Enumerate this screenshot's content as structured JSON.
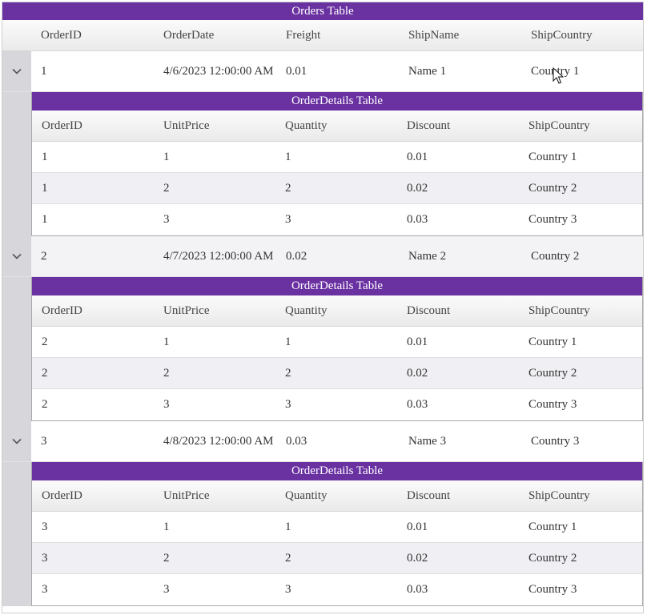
{
  "orders": {
    "caption": "Orders Table",
    "columns": [
      "OrderID",
      "OrderDate",
      "Freight",
      "ShipName",
      "ShipCountry"
    ],
    "rows": [
      {
        "cells": [
          "1",
          "4/6/2023 12:00:00 AM",
          "0.01",
          "Name 1",
          "Country 1"
        ],
        "details": {
          "caption": "OrderDetails Table",
          "columns": [
            "OrderID",
            "UnitPrice",
            "Quantity",
            "Discount",
            "ShipCountry"
          ],
          "rows": [
            [
              "1",
              "1",
              "1",
              "0.01",
              "Country 1"
            ],
            [
              "1",
              "2",
              "2",
              "0.02",
              "Country 2"
            ],
            [
              "1",
              "3",
              "3",
              "0.03",
              "Country 3"
            ]
          ]
        }
      },
      {
        "cells": [
          "2",
          "4/7/2023 12:00:00 AM",
          "0.02",
          "Name 2",
          "Country 2"
        ],
        "details": {
          "caption": "OrderDetails Table",
          "columns": [
            "OrderID",
            "UnitPrice",
            "Quantity",
            "Discount",
            "ShipCountry"
          ],
          "rows": [
            [
              "2",
              "1",
              "1",
              "0.01",
              "Country 1"
            ],
            [
              "2",
              "2",
              "2",
              "0.02",
              "Country 2"
            ],
            [
              "2",
              "3",
              "3",
              "0.03",
              "Country 3"
            ]
          ]
        }
      },
      {
        "cells": [
          "3",
          "4/8/2023 12:00:00 AM",
          "0.03",
          "Name 3",
          "Country 3"
        ],
        "details": {
          "caption": "OrderDetails Table",
          "columns": [
            "OrderID",
            "UnitPrice",
            "Quantity",
            "Discount",
            "ShipCountry"
          ],
          "rows": [
            [
              "3",
              "1",
              "1",
              "0.01",
              "Country 1"
            ],
            [
              "3",
              "2",
              "2",
              "0.02",
              "Country 2"
            ],
            [
              "3",
              "3",
              "3",
              "0.03",
              "Country 3"
            ]
          ]
        }
      }
    ]
  },
  "icons": {
    "expander": "chevron-down-icon",
    "pointer": "mouse-cursor-icon"
  },
  "colors": {
    "caption_bg": "#6a31a1",
    "gutter": "#d6d6db",
    "alt_row": "#f0f0f4"
  }
}
